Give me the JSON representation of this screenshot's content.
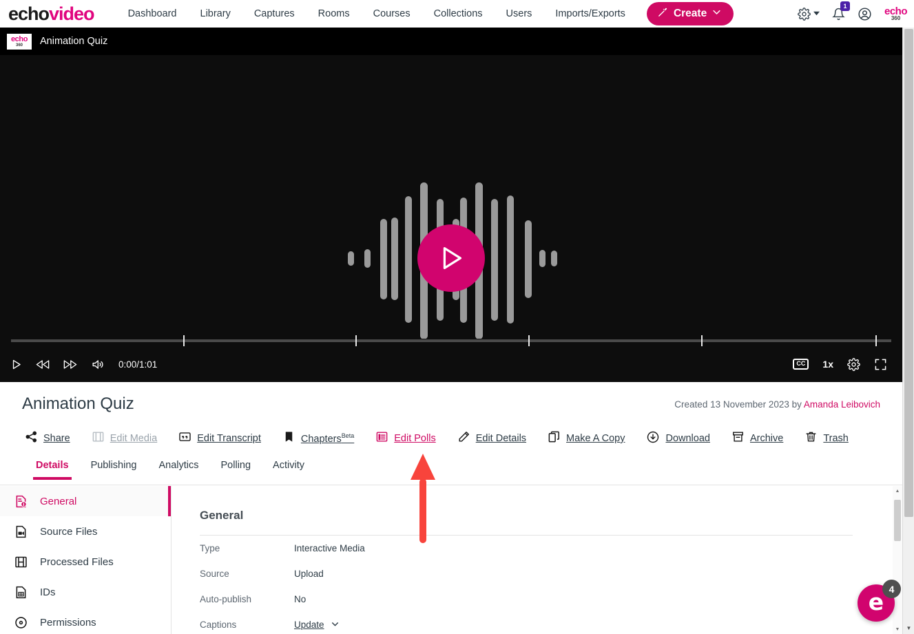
{
  "header": {
    "logo_echo": "echo",
    "logo_video": "video",
    "nav": [
      {
        "label": "Dashboard"
      },
      {
        "label": "Library"
      },
      {
        "label": "Captures"
      },
      {
        "label": "Rooms"
      },
      {
        "label": "Courses"
      },
      {
        "label": "Collections"
      },
      {
        "label": "Users"
      },
      {
        "label": "Imports/Exports"
      }
    ],
    "create_label": "Create",
    "notification_count": "1",
    "brand_mark_top": "echo",
    "brand_mark_bottom": "360"
  },
  "breadcrumb": {
    "logo_top": "echo",
    "logo_bottom": "360",
    "title": "Animation Quiz"
  },
  "player": {
    "time": "0:00/1:01",
    "speed": "1x",
    "cc_label": "CC"
  },
  "page": {
    "title": "Animation Quiz",
    "created_prefix": "Created 13 November 2023 by ",
    "created_author": "Amanda Leibovich"
  },
  "toolbar": [
    {
      "label": "Share",
      "icon": "share-icon",
      "state": "normal"
    },
    {
      "label": "Edit Media",
      "icon": "film-icon",
      "state": "disabled"
    },
    {
      "label": "Edit Transcript",
      "icon": "quote-icon",
      "state": "normal"
    },
    {
      "label": "Chapters",
      "sup": "Beta",
      "icon": "bookmark-icon",
      "state": "normal"
    },
    {
      "label": "Edit Polls",
      "icon": "list-icon",
      "state": "active"
    },
    {
      "label": "Edit Details",
      "icon": "pencil-icon",
      "state": "normal"
    },
    {
      "label": "Make A Copy",
      "icon": "copy-icon",
      "state": "normal"
    },
    {
      "label": "Download",
      "icon": "download-cloud-icon",
      "state": "normal"
    },
    {
      "label": "Archive",
      "icon": "archive-icon",
      "state": "normal"
    },
    {
      "label": "Trash",
      "icon": "trash-icon",
      "state": "normal"
    }
  ],
  "tabs": [
    {
      "label": "Details",
      "selected": true
    },
    {
      "label": "Publishing",
      "selected": false
    },
    {
      "label": "Analytics",
      "selected": false
    },
    {
      "label": "Polling",
      "selected": false
    },
    {
      "label": "Activity",
      "selected": false
    }
  ],
  "sidebar": [
    {
      "label": "General",
      "icon": "document-info-icon",
      "selected": true
    },
    {
      "label": "Source Files",
      "icon": "video-file-icon",
      "selected": false
    },
    {
      "label": "Processed Files",
      "icon": "film-strip-icon",
      "selected": false
    },
    {
      "label": "IDs",
      "icon": "id-file-icon",
      "selected": false
    },
    {
      "label": "Permissions",
      "icon": "lock-icon",
      "selected": false
    }
  ],
  "detail": {
    "heading": "General",
    "rows": [
      {
        "key": "Type",
        "value": "Interactive Media",
        "link": false
      },
      {
        "key": "Source",
        "value": "Upload",
        "link": false
      },
      {
        "key": "Auto-publish",
        "value": "No",
        "link": false
      },
      {
        "key": "Captions",
        "value": "Update",
        "link": true
      }
    ]
  },
  "chat": {
    "glyph": "e",
    "count": "4"
  },
  "colors": {
    "brand_pink": "#cf0a63",
    "accent_magenta": "#e0047e",
    "annotation_red": "#f8443c",
    "player_bg": "#0d0d0d",
    "text_dark": "#2d3b45"
  }
}
